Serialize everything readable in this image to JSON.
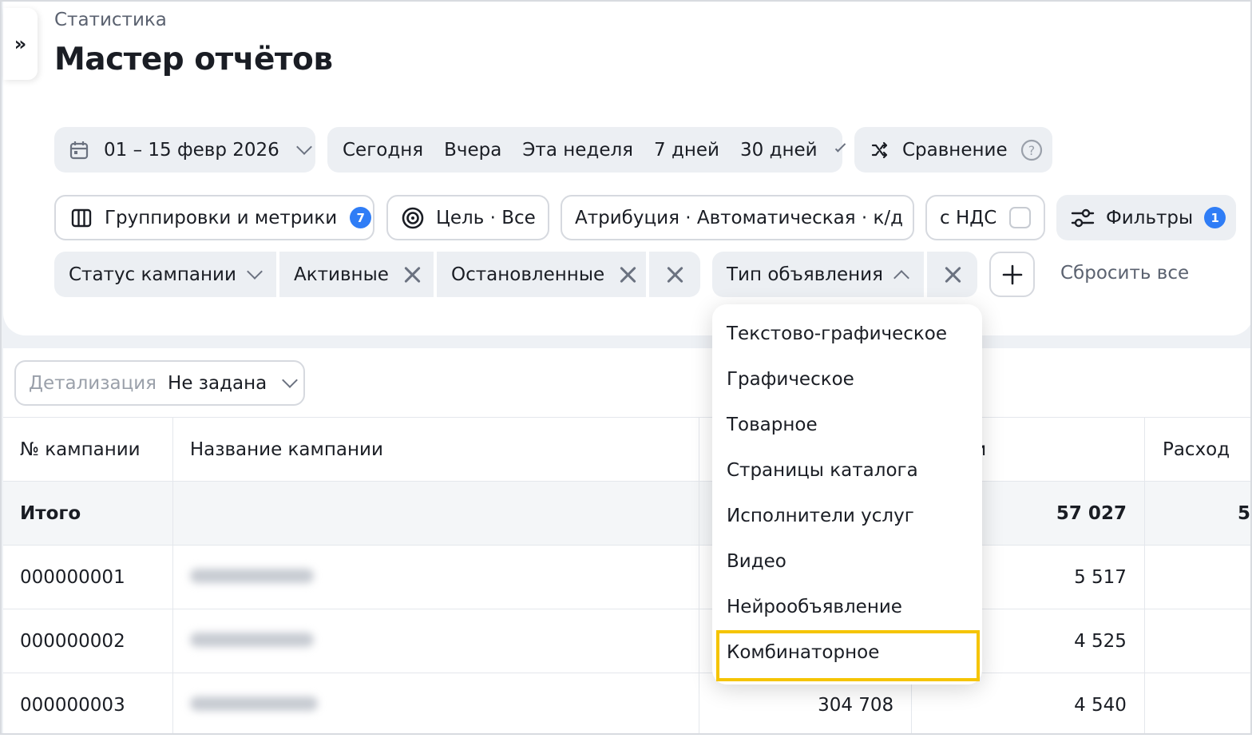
{
  "header": {
    "breadcrumb": "Статистика",
    "title": "Мастер отчётов",
    "sidebar_toggle": "»"
  },
  "period": {
    "date_range": "01 – 15 февр 2026",
    "presets": [
      "Сегодня",
      "Вчера",
      "Эта неделя",
      "7 дней",
      "30 дней"
    ],
    "compare_label": "Сравнение"
  },
  "controls": {
    "groupings_label": "Группировки и метрики",
    "groupings_count": "7",
    "goal_label": "Цель · Все",
    "attribution_label": "Атрибуция · Автоматическая · к/д",
    "vat_label": "с НДС",
    "vat_checked": false,
    "filters_label": "Фильтры",
    "filters_count": "1"
  },
  "filters": {
    "campaign_status_label": "Статус кампании",
    "status_values": [
      "Активные",
      "Остановленные"
    ],
    "ad_type_label": "Тип объявления",
    "reset_all_label": "Сбросить все"
  },
  "detail": {
    "label": "Детализация",
    "value": "Не задана"
  },
  "table": {
    "columns": [
      "№ кампании",
      "Название кампании",
      "",
      "и",
      "Расход"
    ],
    "total_row": {
      "label": "Итого",
      "col4": "57 027",
      "col5": "5"
    },
    "rows": [
      {
        "id": "000000001",
        "col3": "",
        "col4": "5 517"
      },
      {
        "id": "000000002",
        "col3": "",
        "col4": "4 525"
      },
      {
        "id": "000000003",
        "col3": "304 708",
        "col4": "4 540"
      }
    ]
  },
  "ad_type_dropdown": {
    "options": [
      "Текстово-графическое",
      "Графическое",
      "Товарное",
      "Страницы каталога",
      "Исполнители услуг",
      "Видео",
      "Нейрообъявление",
      "Комбинаторное"
    ],
    "highlighted": "Комбинаторное"
  },
  "colors": {
    "accent": "#2f7df6",
    "highlight": "#f5c400",
    "pill_bg": "#eceff3"
  }
}
